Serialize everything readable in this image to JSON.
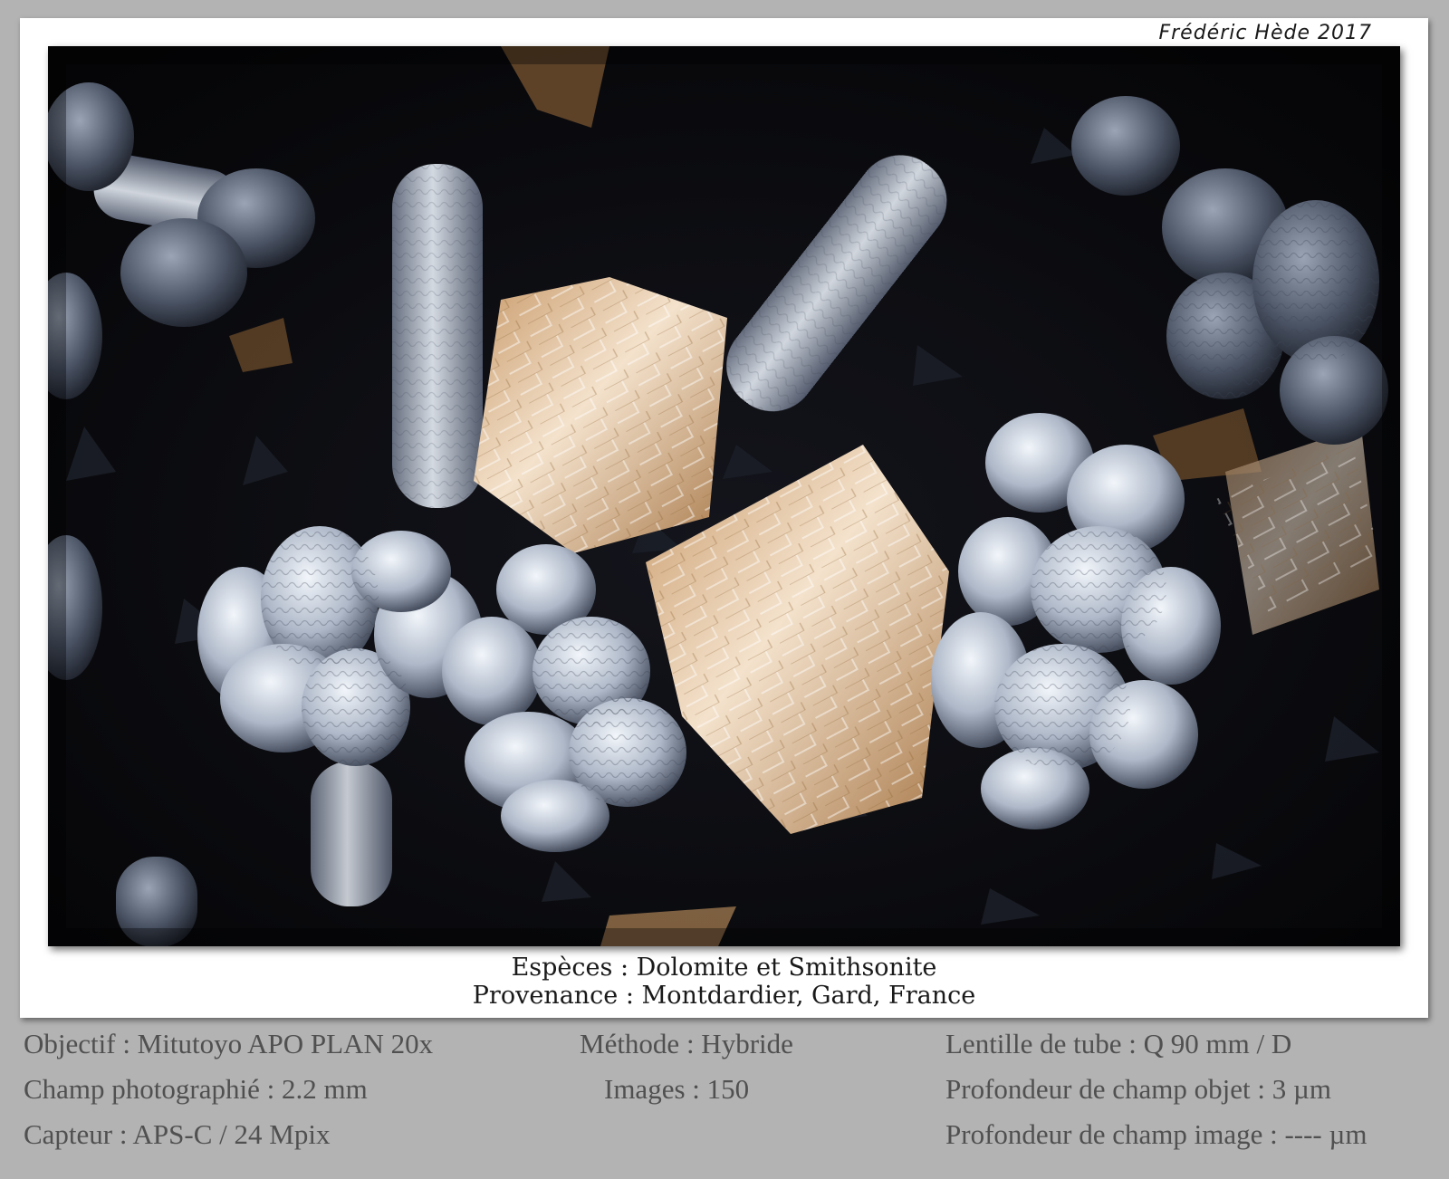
{
  "signature": "Frédéric Hède 2017",
  "photo": {
    "colors": {
      "background": "#07070a",
      "crystal_white": "#e8eef6",
      "crystal_shadow": "#2b3140",
      "dolomite_beige": "#e8c9a6",
      "dolomite_brown": "#8a6030"
    }
  },
  "caption": {
    "species": "Espèces : Dolomite et Smithsonite",
    "provenance": "Provenance : Montdardier, Gard, France"
  },
  "specs": {
    "objective": "Objectif : Mitutoyo APO PLAN 20x",
    "field": "Champ photographié : 2.2 mm",
    "sensor": "Capteur : APS-C / 24 Mpix",
    "method": "Méthode : Hybride",
    "images": "Images : 150",
    "tube_lens": "Lentille de tube : Q 90 mm / D",
    "dof_object": "Profondeur de champ objet : 3 µm",
    "dof_image": "Profondeur de champ image : ---- µm"
  }
}
